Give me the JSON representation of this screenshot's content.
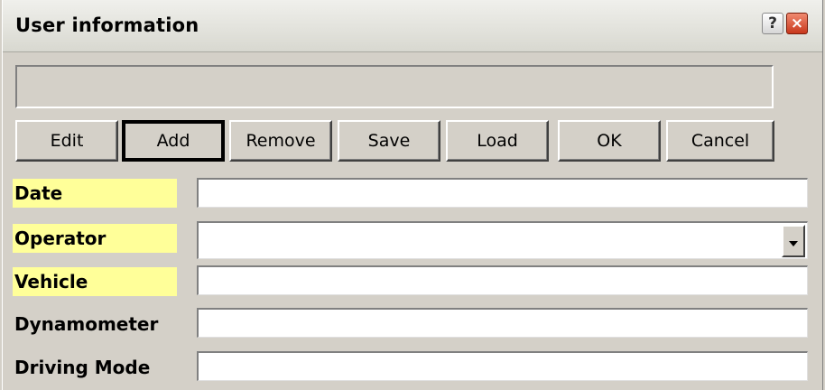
{
  "window": {
    "title": "User information",
    "help_label": "?",
    "close_label": "×"
  },
  "status": {
    "value": ""
  },
  "toolbar": {
    "edit": "Edit",
    "add": "Add",
    "remove": "Remove",
    "save": "Save",
    "load": "Load",
    "ok": "OK",
    "cancel": "Cancel"
  },
  "form": {
    "date": {
      "label": "Date",
      "value": ""
    },
    "operator": {
      "label": "Operator",
      "value": ""
    },
    "vehicle": {
      "label": "Vehicle",
      "value": ""
    },
    "dynamometer": {
      "label": "Dynamometer",
      "value": ""
    },
    "driving_mode": {
      "label": "Driving Mode",
      "value": ""
    }
  },
  "colors": {
    "dialog_bg": "#d4d0c8",
    "required_label_bg": "#ffff99",
    "close_button": "#c8381c"
  }
}
